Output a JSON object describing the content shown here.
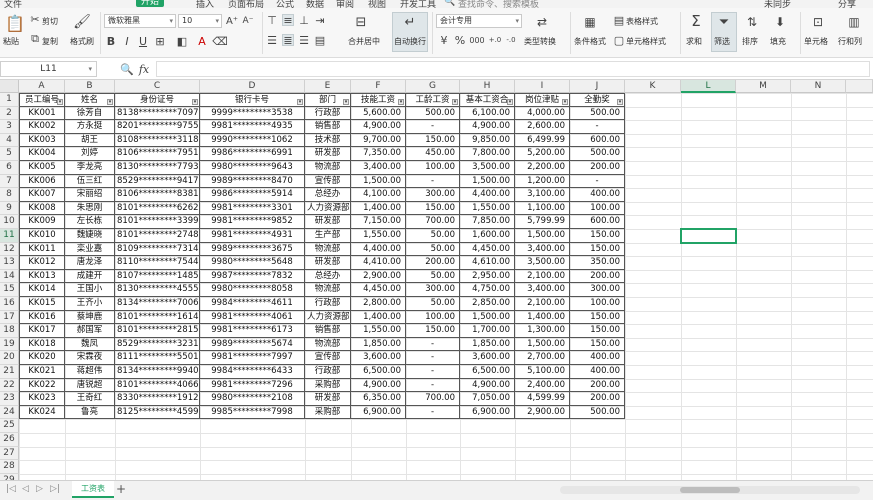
{
  "menu": {
    "items": [
      "文件",
      "开始",
      "插入",
      "页面布局",
      "公式",
      "数据",
      "审阅",
      "视图",
      "开发工具"
    ],
    "search": "查找命令、搜索模板",
    "right_items": [
      "未同步",
      "分享"
    ]
  },
  "ribbon": {
    "paste": "粘贴",
    "cut": "剪切",
    "copy": "复制",
    "format_painter": "格式刷",
    "font_name": "微软雅黑",
    "font_size": "10",
    "merge_center": "合并居中",
    "wrap_text": "自动换行",
    "number_format": "会计专用",
    "type_convert": "类型转换",
    "conditional_format": "条件格式",
    "table_style": "表格样式",
    "cell_style": "单元格样式",
    "sum": "求和",
    "filter": "筛选",
    "sort": "排序",
    "fill": "填充",
    "cell": "单元格",
    "row_col": "行和列"
  },
  "formula_bar": {
    "name_box": "L11",
    "fx": "fx",
    "content": ""
  },
  "columns": [
    "A",
    "B",
    "C",
    "D",
    "E",
    "F",
    "G",
    "H",
    "I",
    "J",
    "K",
    "L",
    "M",
    "N"
  ],
  "selected_column": "L",
  "selected_row": "11",
  "row_numbers": [
    "1",
    "2",
    "3",
    "4",
    "5",
    "6",
    "7",
    "8",
    "9",
    "10",
    "11",
    "12",
    "13",
    "14",
    "15",
    "16",
    "17",
    "18",
    "19",
    "20",
    "21",
    "22",
    "23",
    "24",
    "25",
    "26",
    "27",
    "28",
    "29"
  ],
  "table": {
    "headers": [
      "员工编号",
      "姓名",
      "身份证号",
      "银行卡号",
      "部门",
      "技能工资",
      "工龄工资",
      "基本工资合",
      "岗位津贴",
      "全勤奖"
    ],
    "rows": [
      [
        "KK001",
        "徐芳自",
        "8138*********7097",
        "9999*********3538",
        "行政部",
        "5,600.00",
        "500.00",
        "6,100.00",
        "4,000.00",
        "500.00"
      ],
      [
        "KK002",
        "方永挺",
        "8201*********9755",
        "9981*********4935",
        "销售部",
        "4,900.00",
        "-",
        "4,900.00",
        "2,600.00",
        "-"
      ],
      [
        "KK003",
        "胡王",
        "8108*********3118",
        "9990*********1062",
        "技术部",
        "9,700.00",
        "150.00",
        "9,850.00",
        "6,499.99",
        "600.00"
      ],
      [
        "KK004",
        "刘婷",
        "8106*********7951",
        "9986*********6991",
        "研发部",
        "7,350.00",
        "450.00",
        "7,800.00",
        "5,200.00",
        "500.00"
      ],
      [
        "KK005",
        "李龙亮",
        "8130*********7793",
        "9980*********9643",
        "物流部",
        "3,400.00",
        "100.00",
        "3,500.00",
        "2,200.00",
        "200.00"
      ],
      [
        "KK006",
        "伍三红",
        "8529*********9417",
        "9989*********8470",
        "宣传部",
        "1,500.00",
        "-",
        "1,500.00",
        "1,200.00",
        "-"
      ],
      [
        "KK007",
        "宋丽绍",
        "8106*********8381",
        "9986*********5914",
        "总经办",
        "4,100.00",
        "300.00",
        "4,400.00",
        "3,100.00",
        "400.00"
      ],
      [
        "KK008",
        "朱思刚",
        "8101*********6262",
        "9981*********3301",
        "人力资源部",
        "1,400.00",
        "150.00",
        "1,550.00",
        "1,100.00",
        "100.00"
      ],
      [
        "KK009",
        "左长栋",
        "8101*********3399",
        "9981*********9852",
        "研发部",
        "7,150.00",
        "700.00",
        "7,850.00",
        "5,799.99",
        "600.00"
      ],
      [
        "KK010",
        "魏婕晓",
        "8101*********2748",
        "9981*********4931",
        "生产部",
        "1,550.00",
        "50.00",
        "1,600.00",
        "1,500.00",
        "150.00"
      ],
      [
        "KK011",
        "栾业嘉",
        "8109*********7314",
        "9989*********3675",
        "物流部",
        "4,400.00",
        "50.00",
        "4,450.00",
        "3,400.00",
        "150.00"
      ],
      [
        "KK012",
        "唐龙泽",
        "8110*********7544",
        "9980*********5648",
        "研发部",
        "4,410.00",
        "200.00",
        "4,610.00",
        "3,500.00",
        "350.00"
      ],
      [
        "KK013",
        "成建开",
        "8107*********1485",
        "9987*********7832",
        "总经办",
        "2,900.00",
        "50.00",
        "2,950.00",
        "2,100.00",
        "200.00"
      ],
      [
        "KK014",
        "王国小",
        "8130*********4555",
        "9980*********8058",
        "物流部",
        "4,450.00",
        "300.00",
        "4,750.00",
        "3,400.00",
        "300.00"
      ],
      [
        "KK015",
        "王齐小",
        "8134*********7006",
        "9984*********4611",
        "行政部",
        "2,800.00",
        "50.00",
        "2,850.00",
        "2,100.00",
        "100.00"
      ],
      [
        "KK016",
        "蔡坤鹿",
        "8101*********1614",
        "9981*********4061",
        "人力资源部",
        "1,400.00",
        "100.00",
        "1,500.00",
        "1,400.00",
        "150.00"
      ],
      [
        "KK017",
        "郝国军",
        "8101*********2815",
        "9981*********6173",
        "销售部",
        "1,550.00",
        "150.00",
        "1,700.00",
        "1,300.00",
        "150.00"
      ],
      [
        "KK018",
        "魏凤",
        "8529*********3231",
        "9989*********5674",
        "物流部",
        "1,850.00",
        "-",
        "1,850.00",
        "1,500.00",
        "150.00"
      ],
      [
        "KK020",
        "宋霖夜",
        "8111*********5501",
        "9981*********7997",
        "宣传部",
        "3,600.00",
        "-",
        "3,600.00",
        "2,700.00",
        "400.00"
      ],
      [
        "KK021",
        "蒋超伟",
        "8134*********9940",
        "9984*********6433",
        "行政部",
        "6,500.00",
        "-",
        "6,500.00",
        "5,100.00",
        "400.00"
      ],
      [
        "KK022",
        "唐锐超",
        "8101*********4066",
        "9981*********7296",
        "采购部",
        "4,900.00",
        "-",
        "4,900.00",
        "2,400.00",
        "200.00"
      ],
      [
        "KK023",
        "王奇红",
        "8330*********1912",
        "9980*********2108",
        "研发部",
        "6,350.00",
        "700.00",
        "7,050.00",
        "4,599.99",
        "200.00"
      ],
      [
        "KK024",
        "鲁亮",
        "8125*********4599",
        "9985*********7998",
        "采购部",
        "6,900.00",
        "-",
        "6,900.00",
        "2,900.00",
        "500.00"
      ]
    ]
  },
  "sheet_tab": "工资表"
}
